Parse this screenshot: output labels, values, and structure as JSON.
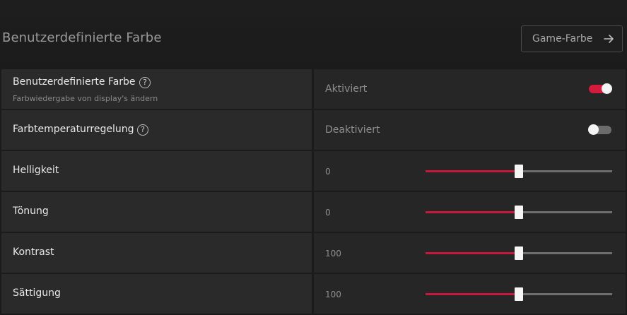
{
  "header": {
    "title": "Benutzerdefinierte Farbe",
    "game_button_label": "Game-Farbe"
  },
  "rows": [
    {
      "label": "Benutzerdefinierte Farbe",
      "sublabel": "Farbwiedergabe von display's ändern",
      "help_icon": "?",
      "state": "Aktiviert",
      "toggle_on": true
    },
    {
      "label": "Farbtemperaturregelung",
      "help_icon": "?",
      "state": "Deaktiviert",
      "toggle_on": false
    },
    {
      "label": "Helligkeit",
      "value": "0",
      "slider_fraction": 0.5
    },
    {
      "label": "Tönung",
      "value": "0",
      "slider_fraction": 0.5
    },
    {
      "label": "Kontrast",
      "value": "100",
      "slider_fraction": 0.5
    },
    {
      "label": "Sättigung",
      "value": "100",
      "slider_fraction": 0.5
    }
  ],
  "colors": {
    "accent": "#d21b3d",
    "background": "#1b1b1b",
    "cell_left": "#2a2a2a",
    "cell_right": "#262626"
  },
  "icons": {
    "help": "question-circle-icon",
    "arrow": "arrow-right-icon"
  }
}
